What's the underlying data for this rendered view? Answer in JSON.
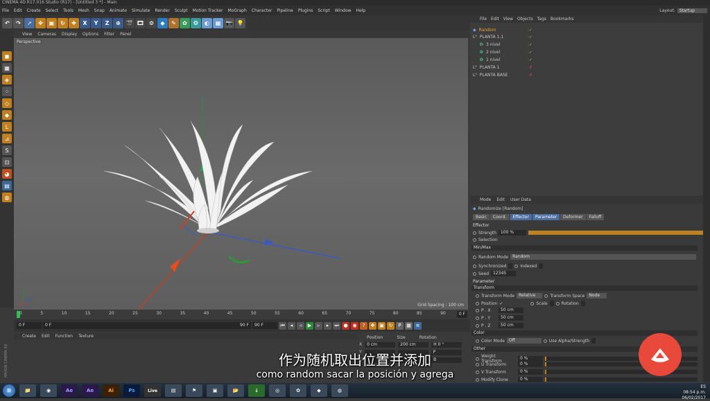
{
  "app": {
    "title": "CINEMA 4D R17.016 Studio (R17) - [Untitled 3 *] - Main"
  },
  "menu": [
    "File",
    "Edit",
    "Create",
    "Select",
    "Tools",
    "Mesh",
    "Snap",
    "Animate",
    "Simulate",
    "Render",
    "Sculpt",
    "Motion Tracker",
    "MoGraph",
    "Character",
    "Pipeline",
    "Plugins",
    "Script",
    "Window",
    "Help"
  ],
  "layout": {
    "label": "Layout:",
    "value": "Startup"
  },
  "viewport": {
    "menu": [
      "View",
      "Cameras",
      "Display",
      "Options",
      "Filter",
      "Panel"
    ],
    "label": "Perspective",
    "grid_spacing": "Grid Spacing : 100 cm"
  },
  "timeline": {
    "ticks": [
      "0",
      "5",
      "10",
      "15",
      "20",
      "25",
      "30",
      "35",
      "40",
      "45",
      "50",
      "55",
      "60",
      "65",
      "70",
      "75",
      "80",
      "85",
      "90"
    ],
    "end": "0 F",
    "start_field": "0 F",
    "from_field": "0 F",
    "to_field": "90 F",
    "end_field": "90 F"
  },
  "materials": {
    "menu": [
      "Create",
      "Edit",
      "Function",
      "Texture"
    ],
    "brand1": "MAXON",
    "brand2": "CINEMA 4D"
  },
  "coords": {
    "headers": [
      "Position",
      "Size",
      "Rotation"
    ],
    "rows": [
      {
        "axis": "X",
        "pos": "0 cm",
        "size": "200 cm",
        "rot": "H 0 °"
      },
      {
        "axis": "Y",
        "pos": "",
        "size": "",
        "rot": "P"
      },
      {
        "axis": "Z",
        "pos": "",
        "size": "",
        "rot": "B"
      }
    ]
  },
  "objects": {
    "menu": [
      "File",
      "Edit",
      "View",
      "Objects",
      "Tags",
      "Bookmarks"
    ],
    "items": [
      {
        "name": "Random",
        "indent": 0,
        "active": true
      },
      {
        "name": "PLANTA 1.1",
        "indent": 0,
        "active": false
      },
      {
        "name": "3 nivel",
        "indent": 1,
        "active": false
      },
      {
        "name": "2 nivel",
        "indent": 1,
        "active": false
      },
      {
        "name": "1 nivel",
        "indent": 1,
        "active": false
      },
      {
        "name": "PLANTA 1",
        "indent": 0,
        "active": false
      },
      {
        "name": "PLANTA BASE",
        "indent": 0,
        "active": false
      }
    ]
  },
  "attributes": {
    "menu": [
      "Mode",
      "Edit",
      "User Data"
    ],
    "title": "Randomize [Random]",
    "tabs": [
      "Basic",
      "Coord.",
      "Effector",
      "Parameter",
      "Deformer",
      "Falloff"
    ],
    "effector": "Effector",
    "strength_label": "Strength",
    "strength_value": "100 %",
    "selection_label": "Selection",
    "minmax": "Min/Max",
    "random_mode_label": "Random Mode",
    "random_mode_value": "Random",
    "synchronized": "Synchronized",
    "indexed": "Indexed",
    "seed_label": "Seed",
    "seed_value": "12345",
    "parameter": "Parameter",
    "transform": "Transform",
    "transform_mode_label": "Transform Mode",
    "transform_mode_value": "Relative",
    "transform_space_label": "Transform Space",
    "transform_space_value": "Node",
    "position": "Position",
    "scale": "Scale",
    "rotation": "Rotation",
    "px": "P . X",
    "py": "P . Y",
    "pz": "P . Z",
    "px_v": "50 cm",
    "py_v": "50 cm",
    "pz_v": "50 cm",
    "color": "Color",
    "color_mode_label": "Color Mode",
    "color_mode_value": "Off",
    "use_alpha": "Use Alpha/Strength",
    "other": "Other",
    "weight": "Weight Transform",
    "u": "U Transform",
    "v": "V Transform",
    "modify": "Modify Clone",
    "weight_v": "0 %",
    "u_v": "0 %",
    "v_v": "0 %",
    "modify_v": "0 %"
  },
  "subtitles": {
    "chinese": "作为随机取出位置并添加",
    "spanish": "como random sacar la posición y agrega"
  },
  "taskbar": {
    "apps": [
      "Ae",
      "Ae",
      "Ai",
      "Ps",
      "Live"
    ],
    "lang": "ES",
    "time": "08:54 p.m.",
    "date": "06/02/2017"
  },
  "colors": {
    "accent": "#4a6ea0",
    "active_object": "#f0a030",
    "logo": "#e8493a"
  }
}
